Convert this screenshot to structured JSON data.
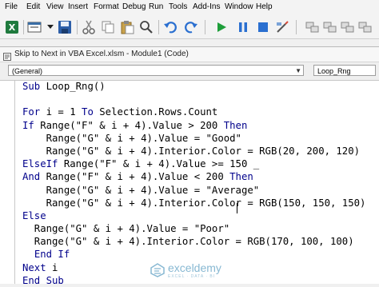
{
  "menu": {
    "items": [
      {
        "label": "File"
      },
      {
        "label": "Edit"
      },
      {
        "label": "View"
      },
      {
        "label": "Insert"
      },
      {
        "label": "Format"
      },
      {
        "label": "Debug"
      },
      {
        "label": "Run"
      },
      {
        "label": "Tools"
      },
      {
        "label": "Add-Ins"
      },
      {
        "label": "Window"
      },
      {
        "label": "Help"
      }
    ]
  },
  "toolbar": {
    "icons": [
      "excel-icon",
      "insert-userform-icon",
      "save-icon",
      "cut-icon",
      "copy-icon",
      "paste-icon",
      "find-icon",
      "undo-icon",
      "redo-icon",
      "run-icon",
      "break-icon",
      "reset-icon",
      "design-mode-icon"
    ]
  },
  "window": {
    "title": "Skip to Next in VBA Excel.xlsm - Module1 (Code)"
  },
  "dropdowns": {
    "object": "(General)",
    "procedure": "Loop_Rng"
  },
  "code": {
    "lines": [
      "Sub Loop_Rng()",
      "",
      "For i = 1 To Selection.Rows.Count",
      "If Range(\"F\" & i + 4).Value > 200 Then",
      "    Range(\"G\" & i + 4).Value = \"Good\"",
      "    Range(\"G\" & i + 4).Interior.Color = RGB(20, 200, 120)",
      "ElseIf Range(\"F\" & i + 4).Value >= 150 _",
      "And Range(\"F\" & i + 4).Value < 200 Then",
      "    Range(\"G\" & i + 4).Value = \"Average\"",
      "    Range(\"G\" & i + 4).Interior.Color = RGB(150, 150, 150)",
      "Else",
      "  Range(\"G\" & i + 4).Value = \"Poor\"",
      "  Range(\"G\" & i + 4).Interior.Color = RGB(170, 100, 100)",
      "  End If",
      "Next i",
      "End Sub"
    ]
  },
  "watermark": {
    "name": "exceldemy",
    "tagline": "EXCEL · DATA · BI"
  },
  "colors": {
    "keyword": "#00008b",
    "run_green": "#1e9e3a",
    "stop_blue": "#2a6fd0"
  }
}
